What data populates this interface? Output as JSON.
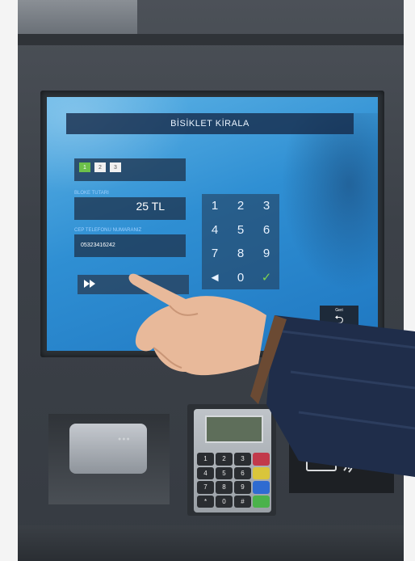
{
  "screen": {
    "title": "BİSİKLET KİRALA",
    "station_boxes": [
      "1",
      "2",
      "3"
    ],
    "active_box_index": 0,
    "deposit_label": "BLOKE TUTARI",
    "deposit_value": "25 TL",
    "phone_label": "CEP TELEFONU NUMARANIZ",
    "phone_value": "05323416242",
    "keypad": [
      "1",
      "2",
      "3",
      "4",
      "5",
      "6",
      "7",
      "8",
      "9",
      "◄",
      "0",
      "✓"
    ],
    "skip_icon": "fast-forward-icon",
    "back_label": "Geri",
    "back_icon": "return-arrow-icon",
    "accent_color": "#2f8fd3",
    "confirm_color": "#7fd24f"
  },
  "pinpad": {
    "keys": [
      "1",
      "2",
      "3",
      "",
      "4",
      "5",
      "6",
      "",
      "7",
      "8",
      "9",
      "",
      "*",
      "0",
      "#",
      ""
    ],
    "function_key_colors": [
      "#c23a4b",
      "#d9c53b",
      "#2f6bd1",
      "#4bb24b"
    ]
  },
  "card_reader": {
    "leds": "●●●"
  },
  "contactless_icon": "contactless-card-icon"
}
